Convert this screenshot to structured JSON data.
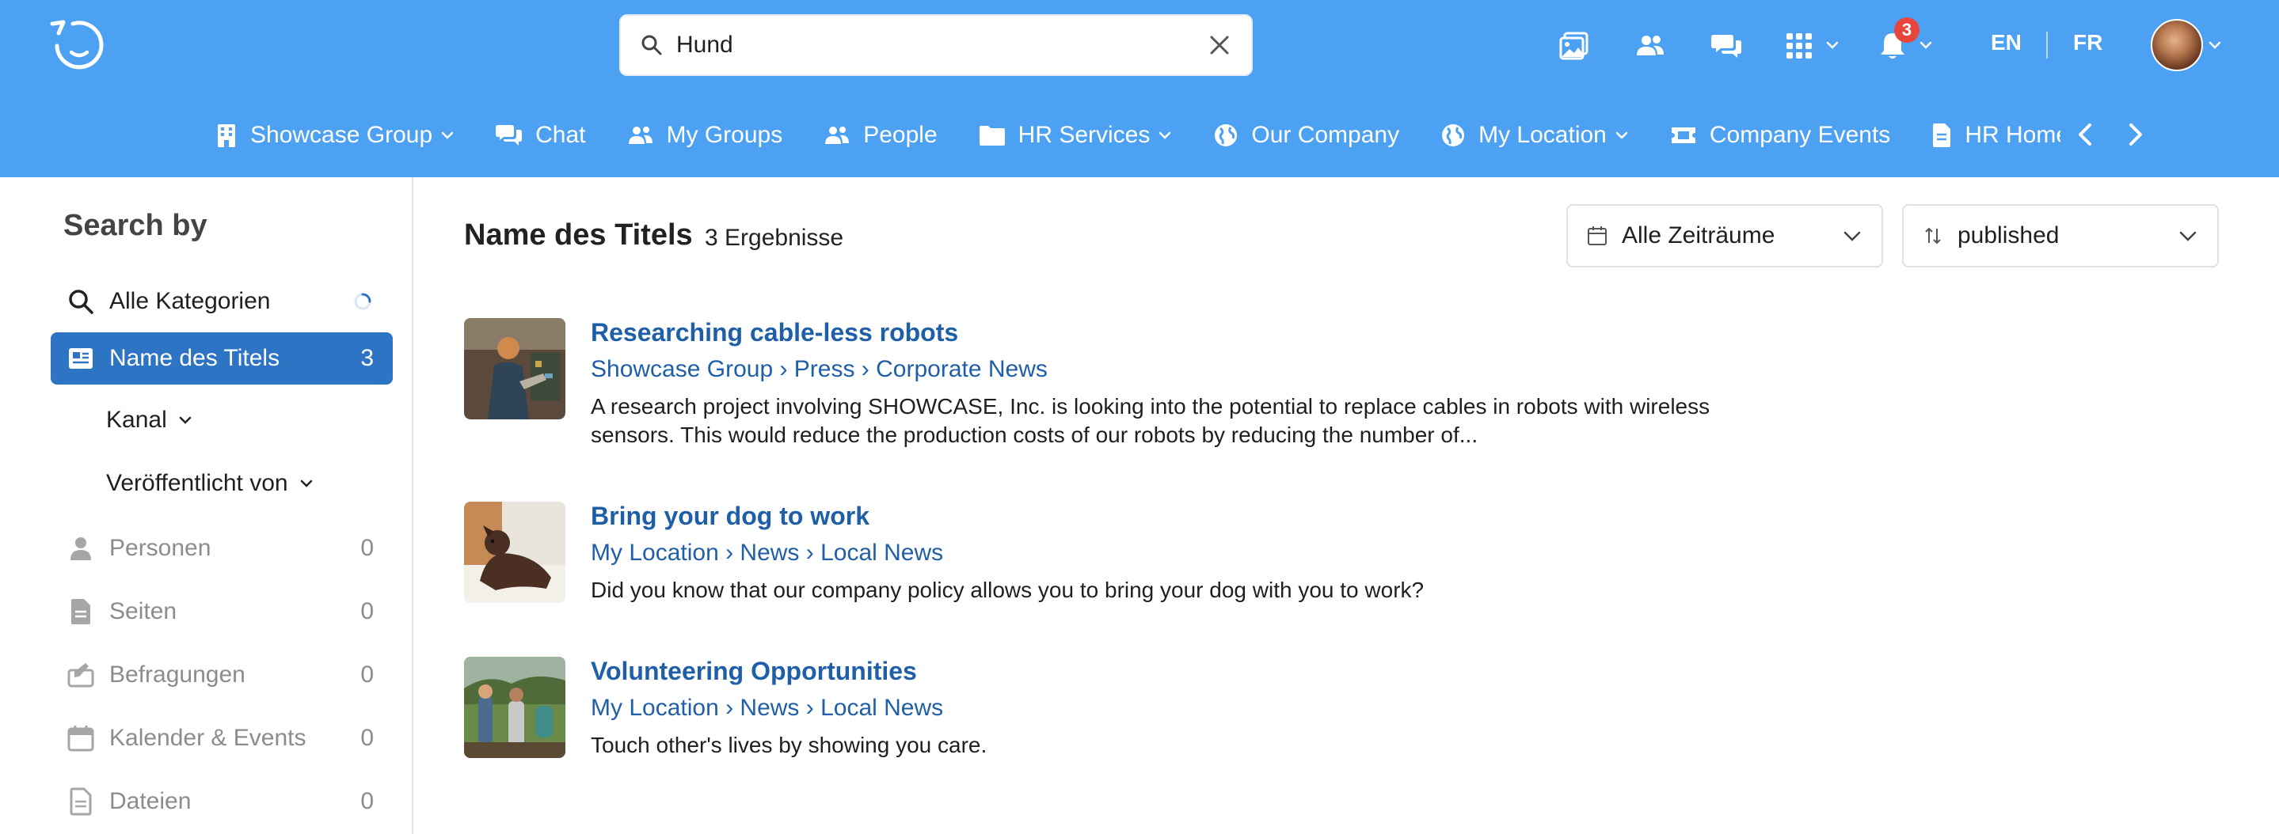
{
  "header": {
    "search": {
      "value": "Hund",
      "placeholder": ""
    },
    "notifications_count": "3",
    "lang_en": "EN",
    "lang_fr": "FR"
  },
  "nav": {
    "items": [
      {
        "label": "Showcase Group",
        "icon": "building-icon",
        "dropdown": true
      },
      {
        "label": "Chat",
        "icon": "chat-icon",
        "dropdown": false
      },
      {
        "label": "My Groups",
        "icon": "groups-icon",
        "dropdown": false
      },
      {
        "label": "People",
        "icon": "people-icon",
        "dropdown": false
      },
      {
        "label": "HR Services",
        "icon": "folder-icon",
        "dropdown": true
      },
      {
        "label": "Our Company",
        "icon": "globe-icon",
        "dropdown": false
      },
      {
        "label": "My Location",
        "icon": "globe-icon",
        "dropdown": true
      },
      {
        "label": "Company Events",
        "icon": "ticket-icon",
        "dropdown": false
      },
      {
        "label": "HR Homepa",
        "icon": "document-icon",
        "dropdown": false
      }
    ]
  },
  "sidebar": {
    "title": "Search by",
    "all_categories": "Alle Kategorien",
    "active": {
      "label": "Name des Titels",
      "count": "3"
    },
    "sub_kanal": "Kanal",
    "sub_published_by": "Veröffentlicht von",
    "items": [
      {
        "label": "Personen",
        "count": "0"
      },
      {
        "label": "Seiten",
        "count": "0"
      },
      {
        "label": "Befragungen",
        "count": "0"
      },
      {
        "label": "Kalender & Events",
        "count": "0"
      },
      {
        "label": "Dateien",
        "count": "0"
      }
    ]
  },
  "main": {
    "title": "Name des Titels",
    "count": "3 Ergebnisse",
    "filter_time": "Alle Zeiträume",
    "filter_sort": "published",
    "results": [
      {
        "title": "Researching cable-less robots",
        "breadcrumb": "Showcase Group › Press › Corporate News",
        "description": "A research project involving SHOWCASE, Inc. is looking into the potential to replace cables in robots with wireless sensors. This would reduce the production costs of our robots by reducing the number of..."
      },
      {
        "title": "Bring your dog to work",
        "breadcrumb": "My Location › News › Local News",
        "description": "Did you know that our company policy allows you to bring your dog with you to work?"
      },
      {
        "title": "Volunteering Opportunities",
        "breadcrumb": "My Location › News › Local News",
        "description": "Touch other's lives by showing you care."
      }
    ]
  },
  "colors": {
    "header_bg": "#4da1f3",
    "active_bg": "#2d74c4",
    "link": "#1f5fa8",
    "badge": "#e8453c"
  }
}
